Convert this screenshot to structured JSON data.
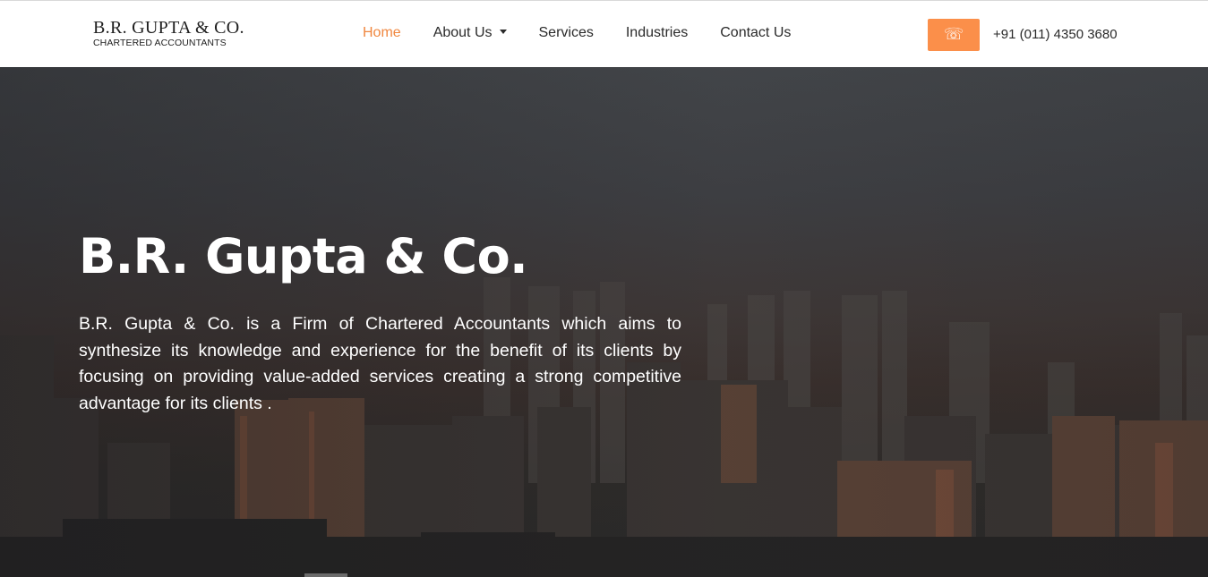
{
  "brand": {
    "name": "B.R. GUPTA & CO.",
    "tagline": "CHARTERED ACCOUNTANTS"
  },
  "nav": {
    "items": [
      {
        "label": "Home",
        "active": true
      },
      {
        "label": "About Us",
        "dropdown": true
      },
      {
        "label": "Services"
      },
      {
        "label": "Industries"
      },
      {
        "label": "Contact Us"
      }
    ],
    "active_color": "#f0873f"
  },
  "contact": {
    "phone_icon": "phone-icon",
    "phone_number": "+91 (011) 4350 3680",
    "button_color": "#fb8f4a"
  },
  "hero": {
    "title": "B.R. Gupta & Co.",
    "description": "B.R. Gupta & Co. is a Firm of Chartered Accountants which aims to synthesize its knowledge and experience for the benefit of its clients by focusing on providing value-added services creating a strong competitive advantage for its clients ."
  }
}
